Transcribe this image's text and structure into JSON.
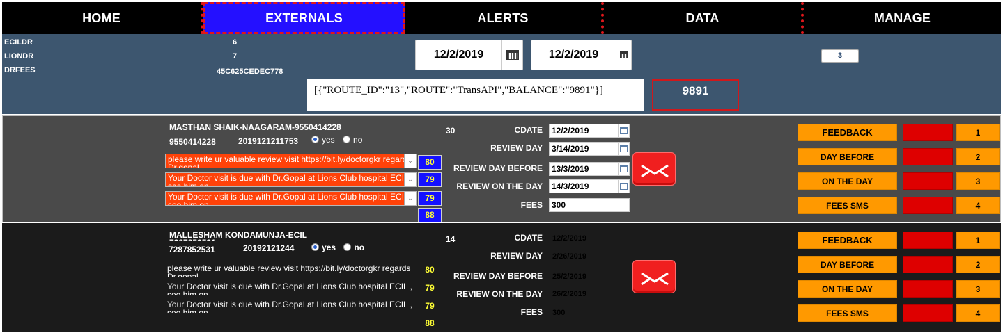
{
  "nav": {
    "tabs": [
      {
        "label": "HOME"
      },
      {
        "label": "EXTERNALS"
      },
      {
        "label": "ALERTS"
      },
      {
        "label": "DATA"
      },
      {
        "label": "MANAGE"
      }
    ],
    "active": "EXTERNALS"
  },
  "info": {
    "ecildr_label": "ECILDR",
    "ecildr_value": "6",
    "liondr_label": "LIONDR",
    "liondr_value": "7",
    "drfees_label": "DRFEES",
    "drfees_value": "45C625CEDEC778",
    "date_from": "12/2/2019",
    "date_to": "12/2/2019",
    "count": "3",
    "json_response": "[{\"ROUTE_ID\":\"13\",\"ROUTE\":\"TransAPI\",\"BALANCE\":\"9891\"}]",
    "balance": "9891"
  },
  "labels": {
    "yes": "yes",
    "no": "no",
    "cdate": "CDATE",
    "review_day": "REVIEW DAY",
    "review_day_before": "REVIEW DAY BEFORE",
    "review_on_the_day": "REVIEW ON THE DAY",
    "fees": "FEES",
    "feedback": "FEEDBACK",
    "day_before": "DAY BEFORE",
    "on_the_day": "ON THE DAY",
    "fees_sms": "FEES SMS",
    "n1": "1",
    "n2": "2",
    "n3": "3",
    "n4": "4"
  },
  "patients": [
    {
      "title": "MASTHAN SHAIK-NAAGARAM-9550414228",
      "phone": "9550414228",
      "id": "2019121211753",
      "radio": "yes",
      "count": "30",
      "messages": [
        {
          "text": "please  write ur valuable review visit https://bit.ly/doctorgkr regards Dr.gopal",
          "len": "80"
        },
        {
          "text": "Your Doctor visit is due with Dr.Gopal at Lions Club hospital ECIL , see him on",
          "len": "79"
        },
        {
          "text": "Your Doctor visit is due with Dr.Gopal at Lions Club hospital ECIL , see him on",
          "len": "79"
        }
      ],
      "extra_len": "88",
      "cdate": "12/2/2019",
      "review_day": "3/14/2019",
      "review_day_before": "13/3/2019",
      "review_on_the_day": "14/3/2019",
      "fees": "300"
    },
    {
      "title": "MALLESHAM KONDAMUNJA-ECIL",
      "subtitle": "7287852531",
      "phone": "7287852531",
      "id": "20192121244",
      "radio": "yes",
      "count": "14",
      "messages": [
        {
          "text": "please  write ur valuable review visit https://bit.ly/doctorgkr regards Dr.gopal",
          "len": "80"
        },
        {
          "text": "Your Doctor visit is due with Dr.Gopal at Lions Club hospital ECIL , see him on",
          "len": "79"
        },
        {
          "text": "Your Doctor visit is due with Dr.Gopal at Lions Club hospital ECIL , see him on",
          "len": "79"
        }
      ],
      "extra_len": "88",
      "cdate": "12/2/2019",
      "review_day": "2/26/2019",
      "review_day_before": "25/2/2019",
      "review_on_the_day": "26/2/2019",
      "fees": "300"
    }
  ]
}
